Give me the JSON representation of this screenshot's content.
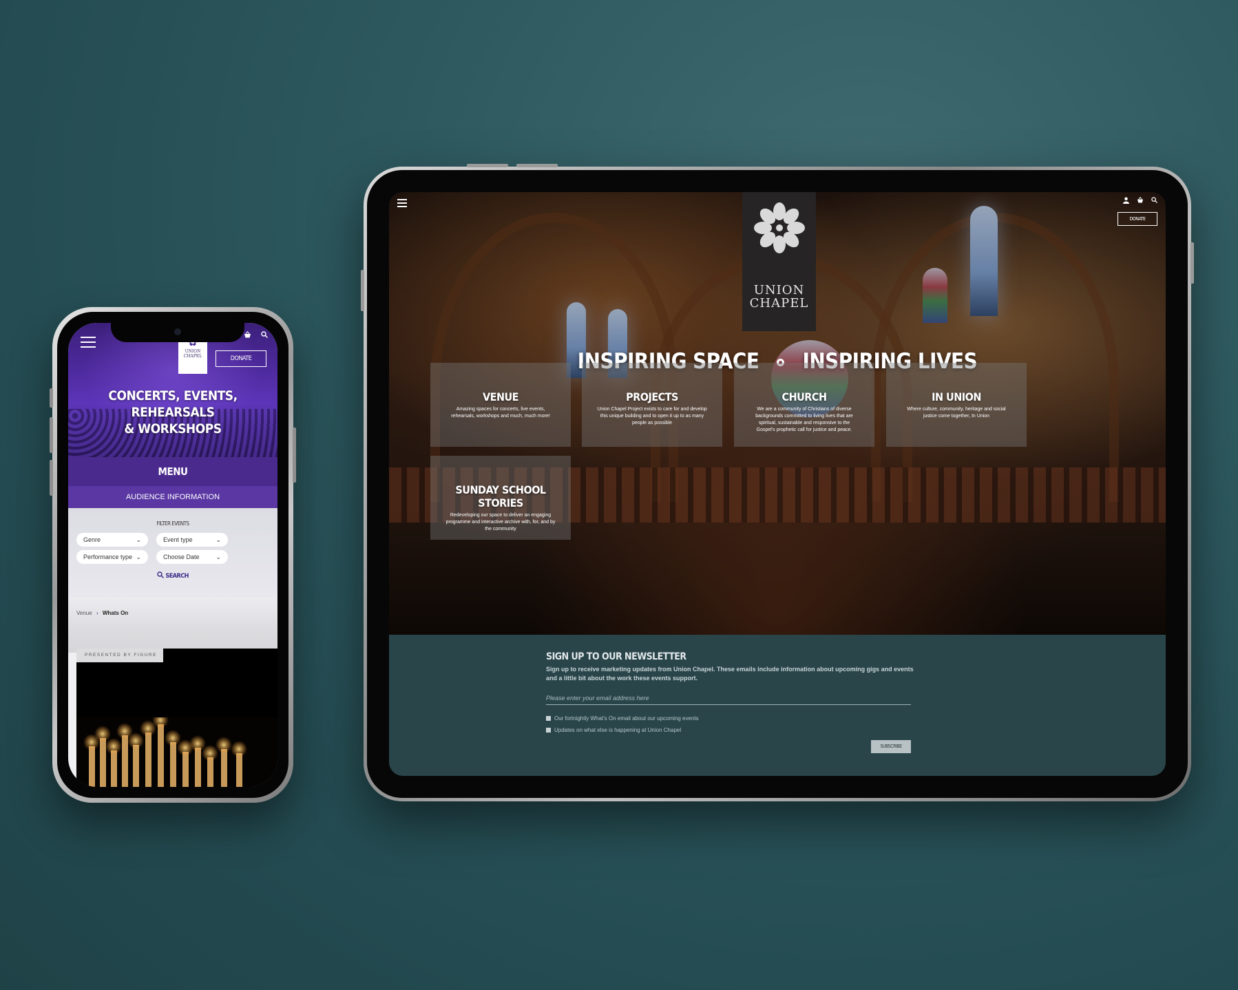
{
  "phone": {
    "header": {
      "logo_line1": "UNION",
      "logo_line2": "CHAPEL",
      "donate_label": "DONATE",
      "icons": [
        "menu-icon",
        "user-icon",
        "basket-icon",
        "search-icon"
      ]
    },
    "hero_title_line1": "CONCERTS, EVENTS, REHEARSALS",
    "hero_title_line2": "& WORKSHOPS",
    "menu_label": "MENU",
    "audience_label": "AUDIENCE INFORMATION",
    "filter": {
      "title": "FILTER EVENTS",
      "genre": "Genre",
      "event_type": "Event type",
      "performance_type": "Performance type",
      "choose_date": "Choose Date",
      "search_label": "SEARCH"
    },
    "breadcrumb": {
      "parent": "Venue",
      "current": "Whats On"
    },
    "card": {
      "tag": "PRESENTED BY FIGURE"
    }
  },
  "tablet": {
    "header": {
      "logo_line1": "UNION",
      "logo_line2": "CHAPEL",
      "donate_label": "DONATE",
      "icons": [
        "menu-icon",
        "user-icon",
        "basket-icon",
        "search-icon"
      ]
    },
    "headline_left": "INSPIRING SPACE",
    "headline_right": "INSPIRING LIVES",
    "tiles": [
      {
        "title": "VENUE",
        "desc": "Amazing spaces for concerts, live events, rehearsals, workshops and much, much more!"
      },
      {
        "title": "PROJECTS",
        "desc": "Union Chapel Project exists to care for and develop this unique building and to open it up to as many people as possible"
      },
      {
        "title": "CHURCH",
        "desc": "We are a community of Christians of diverse backgrounds committed to living lives that are spiritual, sustainable and responsive to the Gospel's prophetic call for justice and peace."
      },
      {
        "title": "IN UNION",
        "desc": "Where culture, community, heritage and social justice come together, In Union"
      },
      {
        "title": "SUNDAY SCHOOL STORIES",
        "desc": "Redeveloping our space to deliver an engaging programme and interactive archive with, for, and by the community"
      }
    ],
    "newsletter": {
      "title": "SIGN UP TO OUR NEWSLETTER",
      "desc": "Sign up to receive marketing updates from Union Chapel. These emails include information about upcoming gigs and events and a little bit about the work these events support.",
      "email_placeholder": "Please enter your email address here",
      "option1": "Our fortnightly What's On email about our upcoming events",
      "option2": "Updates on what else is happening at Union Chapel",
      "subscribe_label": "SUBSCRIBE"
    }
  },
  "colors": {
    "background": "#2e5a60",
    "phone_purple": "#4b2a8e",
    "newsletter_bg": "#29454a"
  }
}
